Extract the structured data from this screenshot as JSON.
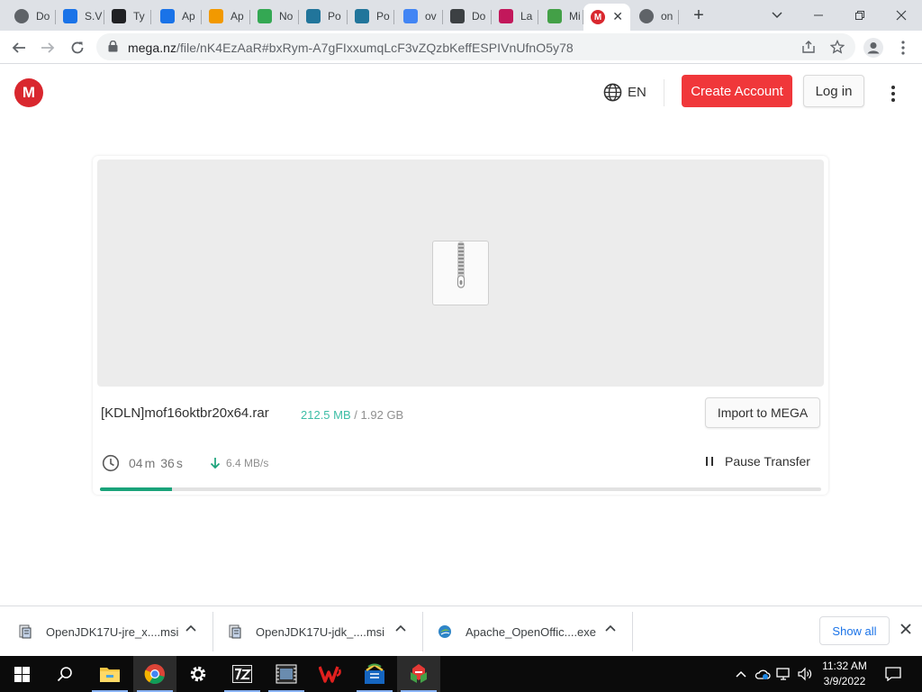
{
  "browser": {
    "tabs": [
      {
        "label": "Do",
        "icon": "globe-icon",
        "color": "#5f6368"
      },
      {
        "label": "S.V",
        "icon": "s-app-icon",
        "color": "#1a73e8"
      },
      {
        "label": "Ty",
        "icon": "typora-icon",
        "color": "#202124"
      },
      {
        "label": "Ap",
        "icon": "app-icon",
        "color": "#1a73e8"
      },
      {
        "label": "Ap",
        "icon": "diamond-icon",
        "color": "#f29900"
      },
      {
        "label": "No",
        "icon": "play-store-icon",
        "color": "#34a853"
      },
      {
        "label": "Po",
        "icon": "wordpress-icon",
        "color": "#21759b"
      },
      {
        "label": "Po",
        "icon": "wordpress-icon",
        "color": "#21759b"
      },
      {
        "label": "ov",
        "icon": "google-icon",
        "color": "#4285f4"
      },
      {
        "label": "Do",
        "icon": "window-icon",
        "color": "#3c4043"
      },
      {
        "label": "La",
        "icon": "triangle-app-icon",
        "color": "#c2185b"
      },
      {
        "label": "Mi",
        "icon": "k-icon",
        "color": "#43a047"
      },
      {
        "label": "",
        "icon": "mega-icon",
        "color": "#d9272e",
        "active": true
      },
      {
        "label": "on",
        "icon": "globe-icon",
        "color": "#5f6368"
      }
    ],
    "tab_close": "✕",
    "new_tab": "+",
    "url_domain": "mega.nz",
    "url_path": "/file/nK4EzAaR#bxRym-A7gFIxxumqLcF3vZQzbKeffESPIVnUfnO5y78"
  },
  "page": {
    "logo_letter": "M",
    "language": "EN",
    "create_account": "Create Account",
    "login": "Log in",
    "file": {
      "name": "[KDLN]mof16oktbr20x64.rar",
      "downloaded": "212.5 MB",
      "size_sep": "/",
      "total": "1.92 GB",
      "import_label": "Import to MEGA",
      "time_min": "04",
      "time_min_unit": "m",
      "time_sec": "36",
      "time_sec_unit": "s",
      "speed": "6.4 MB/s",
      "pause_label": "Pause Transfer",
      "progress": 0.1
    }
  },
  "shelf": {
    "downloads": [
      {
        "name": "OpenJDK17U-jre_x....msi",
        "icon": "msi-installer-icon"
      },
      {
        "name": "OpenJDK17U-jdk_....msi",
        "icon": "msi-installer-icon"
      },
      {
        "name": "Apache_OpenOffic....exe",
        "icon": "openoffice-installer-icon"
      }
    ],
    "show_all": "Show all"
  },
  "taskbar": {
    "time": "11:32 AM",
    "date": "3/9/2022"
  },
  "colors": {
    "mega_red": "#d9272e",
    "create_button": "#f0373a",
    "progress_green": "#1aa37a",
    "downloaded_teal": "#3dbda6"
  }
}
